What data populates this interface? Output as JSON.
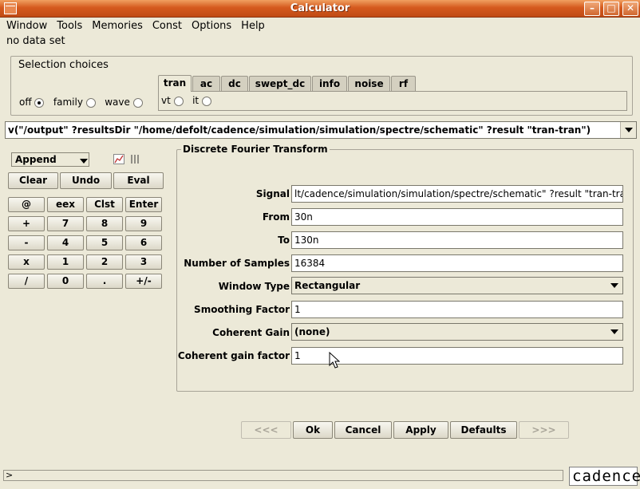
{
  "window": {
    "title": "Calculator"
  },
  "menu": [
    "Window",
    "Tools",
    "Memories",
    "Const",
    "Options",
    "Help"
  ],
  "status_text": "no data set",
  "selection": {
    "title": "Selection choices",
    "modes": [
      {
        "label": "off",
        "selected": true
      },
      {
        "label": "family",
        "selected": false
      },
      {
        "label": "wave",
        "selected": false
      }
    ],
    "tabs": [
      "tran",
      "ac",
      "dc",
      "swept_dc",
      "info",
      "noise",
      "rf"
    ],
    "active_tab": "tran",
    "tab_radios": [
      {
        "label": "vt",
        "selected": false
      },
      {
        "label": "it",
        "selected": false
      }
    ]
  },
  "expression": "v(\"/output\" ?resultsDir \"/home/defolt/cadence/simulation/simulation/spectre/schematic\" ?result \"tran-tran\")",
  "calc": {
    "mode_select": "Append",
    "clear": "Clear",
    "undo": "Undo",
    "eval": "Eval",
    "keys": [
      [
        "@",
        "eex",
        "Clst",
        "Enter"
      ],
      [
        "+",
        "7",
        "8",
        "9"
      ],
      [
        "-",
        "4",
        "5",
        "6"
      ],
      [
        "x",
        "1",
        "2",
        "3"
      ],
      [
        "/",
        "0",
        ".",
        "+/-"
      ]
    ]
  },
  "dft": {
    "title": "Discrete Fourier Transform",
    "fields": [
      {
        "label": "Signal",
        "value": "lt/cadence/simulation/simulation/spectre/schematic\" ?result \"tran-tran\"",
        "type": "text"
      },
      {
        "label": "From",
        "value": "30n",
        "type": "text"
      },
      {
        "label": "To",
        "value": "130n",
        "type": "text"
      },
      {
        "label": "Number of Samples",
        "value": "16384",
        "type": "text"
      },
      {
        "label": "Window Type",
        "value": "Rectangular",
        "type": "select"
      },
      {
        "label": "Smoothing Factor",
        "value": "1",
        "type": "text"
      },
      {
        "label": "Coherent Gain",
        "value": "(none)",
        "type": "select"
      },
      {
        "label": "Coherent gain factor",
        "value": "1",
        "type": "text"
      }
    ]
  },
  "footer_buttons": [
    {
      "label": "<<<",
      "enabled": false
    },
    {
      "label": "Ok",
      "enabled": true
    },
    {
      "label": "Cancel",
      "enabled": true
    },
    {
      "label": "Apply",
      "enabled": true
    },
    {
      "label": "Defaults",
      "enabled": true
    },
    {
      "label": ">>>",
      "enabled": false
    }
  ],
  "command_line": ">",
  "logo_text": "cadence"
}
